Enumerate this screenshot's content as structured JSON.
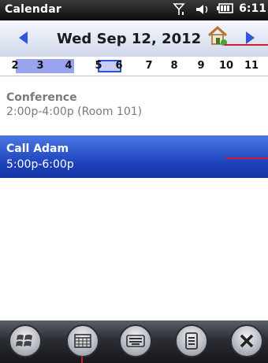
{
  "status_bar": {
    "app_title": "Calendar",
    "time": "6:11",
    "icons": [
      "signal-icon",
      "volume-icon",
      "battery-icon"
    ]
  },
  "date_header": {
    "date": "Wed Sep 12, 2012",
    "icons": [
      "previous-day-icon",
      "today-home-icon",
      "next-day-icon"
    ]
  },
  "week_strip": {
    "days": [
      "2",
      "3",
      "4",
      "5",
      "6",
      "7",
      "8",
      "9",
      "10",
      "11"
    ]
  },
  "appointments": [
    {
      "title": "Conference",
      "details": "2:00p-4:00p (Room 101)"
    },
    {
      "title": "Call Adam",
      "details": "5:00p-6:00p"
    }
  ],
  "toolbar": {
    "buttons": [
      "start-menu-icon",
      "calendar-view-icon",
      "keyboard-icon",
      "menu-icon",
      "close-icon"
    ]
  },
  "colors": {
    "selected_appointment": "#1a3fb8",
    "nav_arrow": "#2f57d8",
    "annotation_line": "#d11a2a"
  }
}
